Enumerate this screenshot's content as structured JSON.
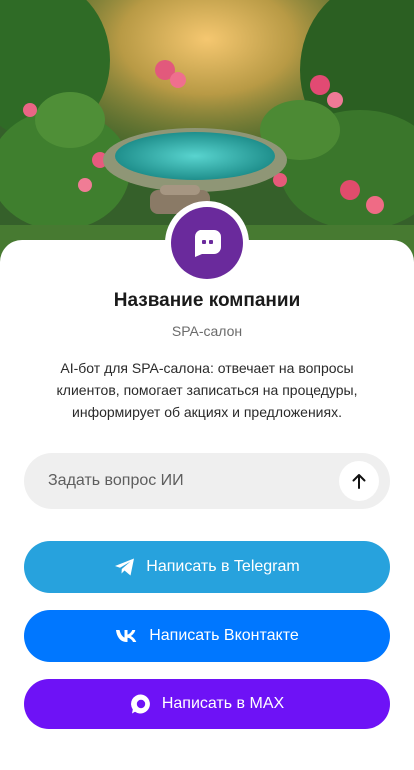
{
  "company": {
    "name": "Название компании",
    "category": "SPA-салон",
    "description": "AI-бот для SPA-салона: отвечает на вопросы клиентов, помогает записаться на процедуры, информирует об акциях и предложениях."
  },
  "ask": {
    "placeholder": "Задать вопрос ИИ"
  },
  "buttons": {
    "telegram": "Написать в Telegram",
    "vk": "Написать Вконтакте",
    "max": "Написать в MAX"
  },
  "colors": {
    "avatar": "#6a2a9c",
    "telegram": "#27a2dd",
    "vk": "#0077ff",
    "max": "#6e12f6",
    "ask_field": "#efefef"
  },
  "icons": {
    "avatar": "chat-bot-icon",
    "send": "arrow-up-icon",
    "telegram": "telegram-icon",
    "vk": "vk-icon",
    "max": "max-icon"
  }
}
